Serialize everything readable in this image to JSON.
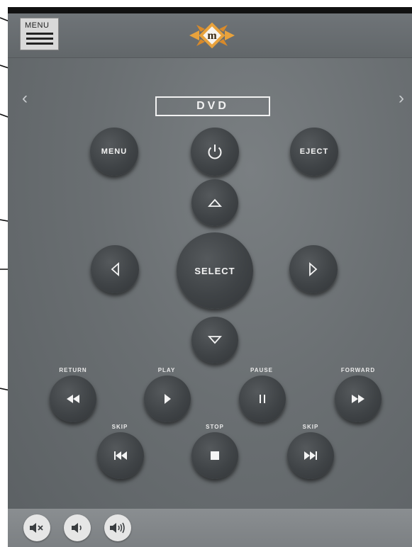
{
  "header": {
    "menu_label": "MENU",
    "logo_letter": "m"
  },
  "source": {
    "label": "DVD"
  },
  "nav": {
    "prev_glyph": "‹",
    "next_glyph": "›"
  },
  "buttons": {
    "menu": "MENU",
    "eject": "EJECT",
    "select": "SELECT"
  },
  "transport": {
    "return": "RETURN",
    "play": "PLAY",
    "pause": "PAUSE",
    "forward": "FORWARD",
    "skip_back": "SKIP",
    "stop": "STOP",
    "skip_forward": "SKIP"
  },
  "colors": {
    "button": "#3f4346",
    "background": "#6a6f72",
    "logo_orange": "#e8a23c",
    "text": "#f4f4f4"
  }
}
